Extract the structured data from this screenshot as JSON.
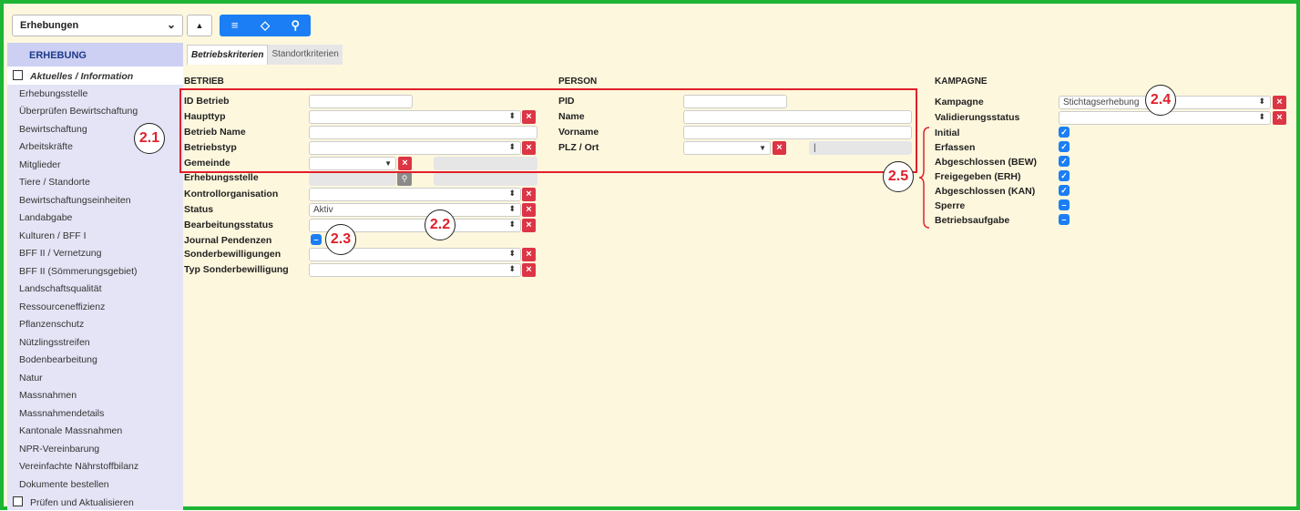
{
  "topbar": {
    "select_value": "Erhebungen",
    "chevron_icon": "chevron-down-icon",
    "up_icon": "caret-up-icon",
    "list_icon": "list-icon",
    "eraser_icon": "eraser-icon",
    "search_icon": "search-icon"
  },
  "sidebar": {
    "header": "ERHEBUNG",
    "items": [
      "Aktuelles / Information",
      "Erhebungsstelle",
      "Überprüfen Bewirtschaftung",
      "Bewirtschaftung",
      "Arbeitskräfte",
      "Mitglieder",
      "Tiere / Standorte",
      "Bewirtschaftungseinheiten",
      "Landabgabe",
      "Kulturen / BFF I",
      "BFF II / Vernetzung",
      "BFF II (Sömmerungsgebiet)",
      "Landschaftsqualität",
      "Ressourceneffizienz",
      "Pflanzenschutz",
      "Nützlingsstreifen",
      "Bodenbearbeitung",
      "Natur",
      "Massnahmen",
      "Massnahmendetails",
      "Kantonale Massnahmen",
      "NPR-Vereinbarung",
      "Vereinfachte Nährstoffbilanz",
      "Dokumente bestellen",
      "Prüfen und Aktualisieren"
    ]
  },
  "tabs": [
    "Betriebskriterien",
    "Standortkriterien"
  ],
  "betrieb": {
    "title": "BETRIEB",
    "labels": [
      "ID Betrieb",
      "Haupttyp",
      "Betrieb Name",
      "Betriebstyp",
      "Gemeinde",
      "Erhebungsstelle",
      "Kontrollorganisation",
      "Status",
      "Bearbeitungsstatus",
      "Journal Pendenzen",
      "Sonderbewilligungen",
      "Typ Sonderbewilligung"
    ],
    "status_value": "Aktiv"
  },
  "person": {
    "title": "PERSON",
    "labels": [
      "PID",
      "Name",
      "Vorname",
      "PLZ / Ort"
    ]
  },
  "kampagne": {
    "title": "KAMPAGNE",
    "labels": [
      "Kampagne",
      "Validierungsstatus"
    ],
    "kampagne_value": "Stichtagserhebung",
    "status_items": [
      {
        "label": "Initial",
        "state": "checked"
      },
      {
        "label": "Erfassen",
        "state": "checked"
      },
      {
        "label": "Abgeschlossen (BEW)",
        "state": "checked"
      },
      {
        "label": "Freigegeben (ERH)",
        "state": "checked"
      },
      {
        "label": "Abgeschlossen (KAN)",
        "state": "checked"
      },
      {
        "label": "Sperre",
        "state": "indeterminate"
      },
      {
        "label": "Betriebsaufgabe",
        "state": "indeterminate"
      }
    ]
  },
  "annotations": [
    "2.1",
    "2.2",
    "2.3",
    "2.4",
    "2.5"
  ],
  "colors": {
    "frame": "#1db533",
    "background": "#fdf7dd",
    "sidebar": "#e4e4f6",
    "accent": "#1b7ef5",
    "clear_button": "#dc3545",
    "annotation": "#e0202a"
  }
}
